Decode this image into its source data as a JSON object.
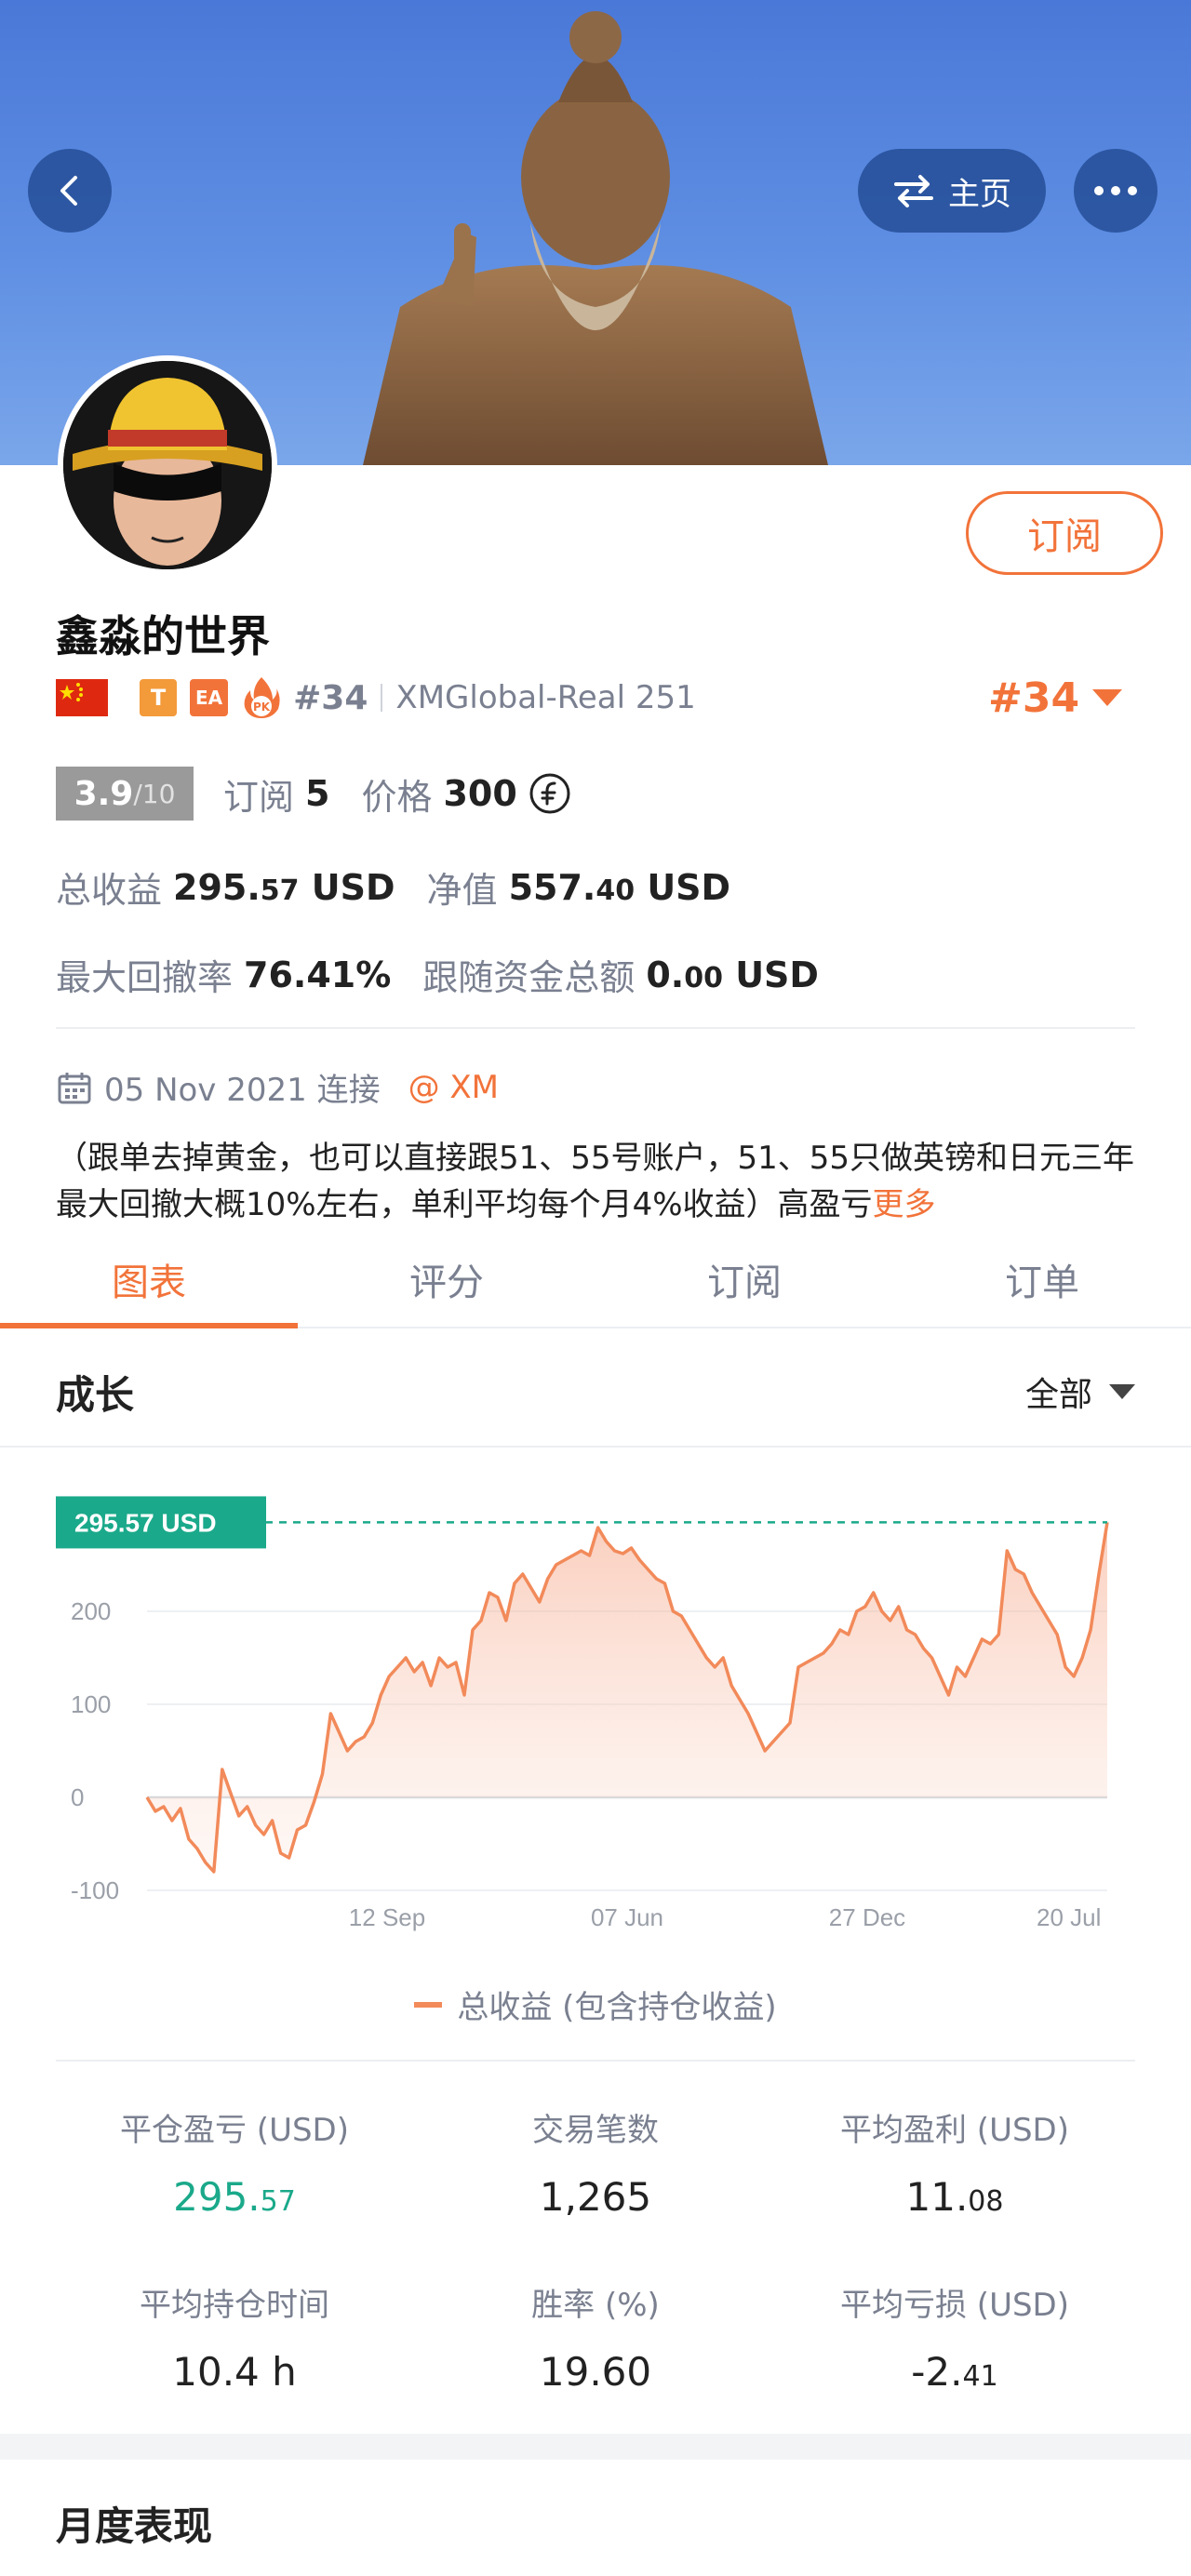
{
  "header": {
    "home_label": "主页"
  },
  "profile": {
    "subscribe_label": "订阅",
    "name": "鑫淼的世界",
    "badge_t": "T",
    "badge_ea": "EA",
    "rank": "#34",
    "broker": "XMGlobal-Real 251",
    "rank_select": "#34",
    "score_value": "3.9",
    "score_max": "/10",
    "subscriptions_label": "订阅",
    "subscriptions_value": "5",
    "price_label": "价格",
    "price_value": "300",
    "total_profit_label": "总收益",
    "total_profit_int": "295.",
    "total_profit_dec": "57",
    "total_profit_unit": "USD",
    "equity_label": "净值",
    "equity_int": "557.",
    "equity_dec": "40",
    "equity_unit": "USD",
    "max_drawdown_label": "最大回撤率",
    "max_drawdown_value": "76.41%",
    "follow_funds_label": "跟随资金总额",
    "follow_funds_int": "0.",
    "follow_funds_dec": "00",
    "follow_funds_unit": "USD",
    "connected_date": "05 Nov 2021 连接",
    "connected_broker": "@ XM",
    "description": "（跟单去掉黄金，也可以直接跟51、55号账户，51、55只做英镑和日元三年最大回撤大概10%左右，单利平均每个月4%收益）高盈亏",
    "more_label": "更多"
  },
  "tabs": [
    {
      "label": "图表",
      "active": true
    },
    {
      "label": "评分",
      "active": false
    },
    {
      "label": "订阅",
      "active": false
    },
    {
      "label": "订单",
      "active": false
    }
  ],
  "growth": {
    "title": "成长",
    "range_label": "全部"
  },
  "chart_data": {
    "type": "area",
    "current_label": "295.57 USD",
    "current_value": 295.57,
    "yticks": [
      200,
      100,
      0,
      -100
    ],
    "ytick_labels": [
      "200",
      "100",
      "0",
      "-100"
    ],
    "xtick_labels": [
      "12 Sep",
      "07 Jun",
      "27 Dec",
      "20 Jul"
    ],
    "xtick_positions": [
      0.25,
      0.5,
      0.75,
      0.96
    ],
    "ylim": [
      -100,
      295.57
    ],
    "legend": "总收益 (包含持仓收益)",
    "series_color": "#f28a5a",
    "highlight_color": "#1aa98a",
    "values": [
      0,
      -15,
      -10,
      -25,
      -12,
      -45,
      -55,
      -70,
      -80,
      30,
      5,
      -20,
      -10,
      -30,
      -40,
      -25,
      -60,
      -65,
      -35,
      -30,
      -5,
      25,
      90,
      70,
      50,
      60,
      65,
      80,
      110,
      130,
      140,
      150,
      135,
      145,
      120,
      150,
      140,
      145,
      110,
      180,
      190,
      220,
      215,
      190,
      230,
      240,
      225,
      210,
      235,
      250,
      255,
      260,
      265,
      260,
      290,
      275,
      265,
      262,
      268,
      255,
      245,
      235,
      230,
      200,
      195,
      180,
      165,
      150,
      140,
      150,
      120,
      105,
      90,
      70,
      50,
      60,
      70,
      80,
      140,
      145,
      150,
      155,
      165,
      180,
      175,
      200,
      205,
      220,
      200,
      190,
      205,
      180,
      175,
      160,
      150,
      130,
      110,
      140,
      130,
      150,
      170,
      165,
      175,
      265,
      245,
      240,
      220,
      205,
      190,
      175,
      140,
      130,
      150,
      180,
      240,
      295.57
    ]
  },
  "metrics": [
    {
      "label": "平仓盈亏 (USD)",
      "int": "295.",
      "dec": "57",
      "green": true
    },
    {
      "label": "交易笔数",
      "int": "1,265",
      "dec": "",
      "green": false
    },
    {
      "label": "平均盈利 (USD)",
      "int": "11.",
      "dec": "08",
      "green": false
    },
    {
      "label": "平均持仓时间",
      "int": "10.4 h",
      "dec": "",
      "green": false
    },
    {
      "label": "胜率 (%)",
      "int": "19.60",
      "dec": "",
      "green": false
    },
    {
      "label": "平均亏损 (USD)",
      "int": "-2.",
      "dec": "41",
      "green": false
    }
  ],
  "monthly": {
    "title": "月度表现"
  }
}
